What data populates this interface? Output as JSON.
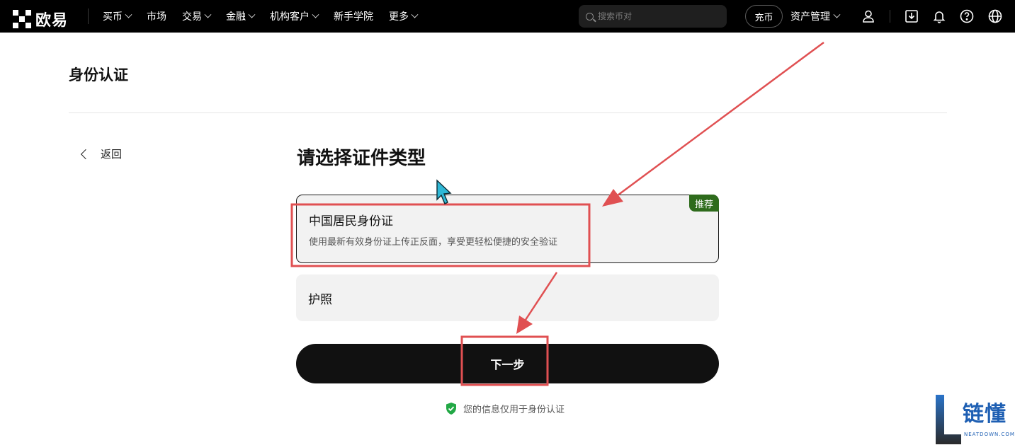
{
  "header": {
    "logo_text": "欧易",
    "nav": [
      {
        "label": "买币",
        "has_dropdown": true
      },
      {
        "label": "市场",
        "has_dropdown": false
      },
      {
        "label": "交易",
        "has_dropdown": true
      },
      {
        "label": "金融",
        "has_dropdown": true
      },
      {
        "label": "机构客户",
        "has_dropdown": true
      },
      {
        "label": "新手学院",
        "has_dropdown": false
      },
      {
        "label": "更多",
        "has_dropdown": true
      }
    ],
    "search_placeholder": "搜索币对",
    "deposit_label": "充币",
    "assets_label": "资产管理",
    "icons": [
      "user-icon",
      "download-icon",
      "bell-icon",
      "help-icon",
      "globe-icon"
    ]
  },
  "page": {
    "title": "身份认证",
    "back_label": "返回",
    "section_title": "请选择证件类型",
    "options": [
      {
        "title": "中国居民身份证",
        "description": "使用最新有效身份证上传正反面，享受更轻松便捷的安全验证",
        "badge": "推荐",
        "selected": true
      },
      {
        "title": "护照",
        "description": "",
        "badge": "",
        "selected": false
      }
    ],
    "next_label": "下一步",
    "privacy_note": "您的信息仅用于身份认证"
  },
  "watermark": {
    "text": "链懂",
    "sub": "NEATDOWN.COM"
  },
  "colors": {
    "topbar_bg": "#000000",
    "card_bg": "#f2f2f2",
    "badge_bg": "#2e6b1c",
    "button_bg": "#111111",
    "annotation_red": "#e05052",
    "shield_green": "#22a845",
    "watermark_blue": "#1e5fb3"
  }
}
